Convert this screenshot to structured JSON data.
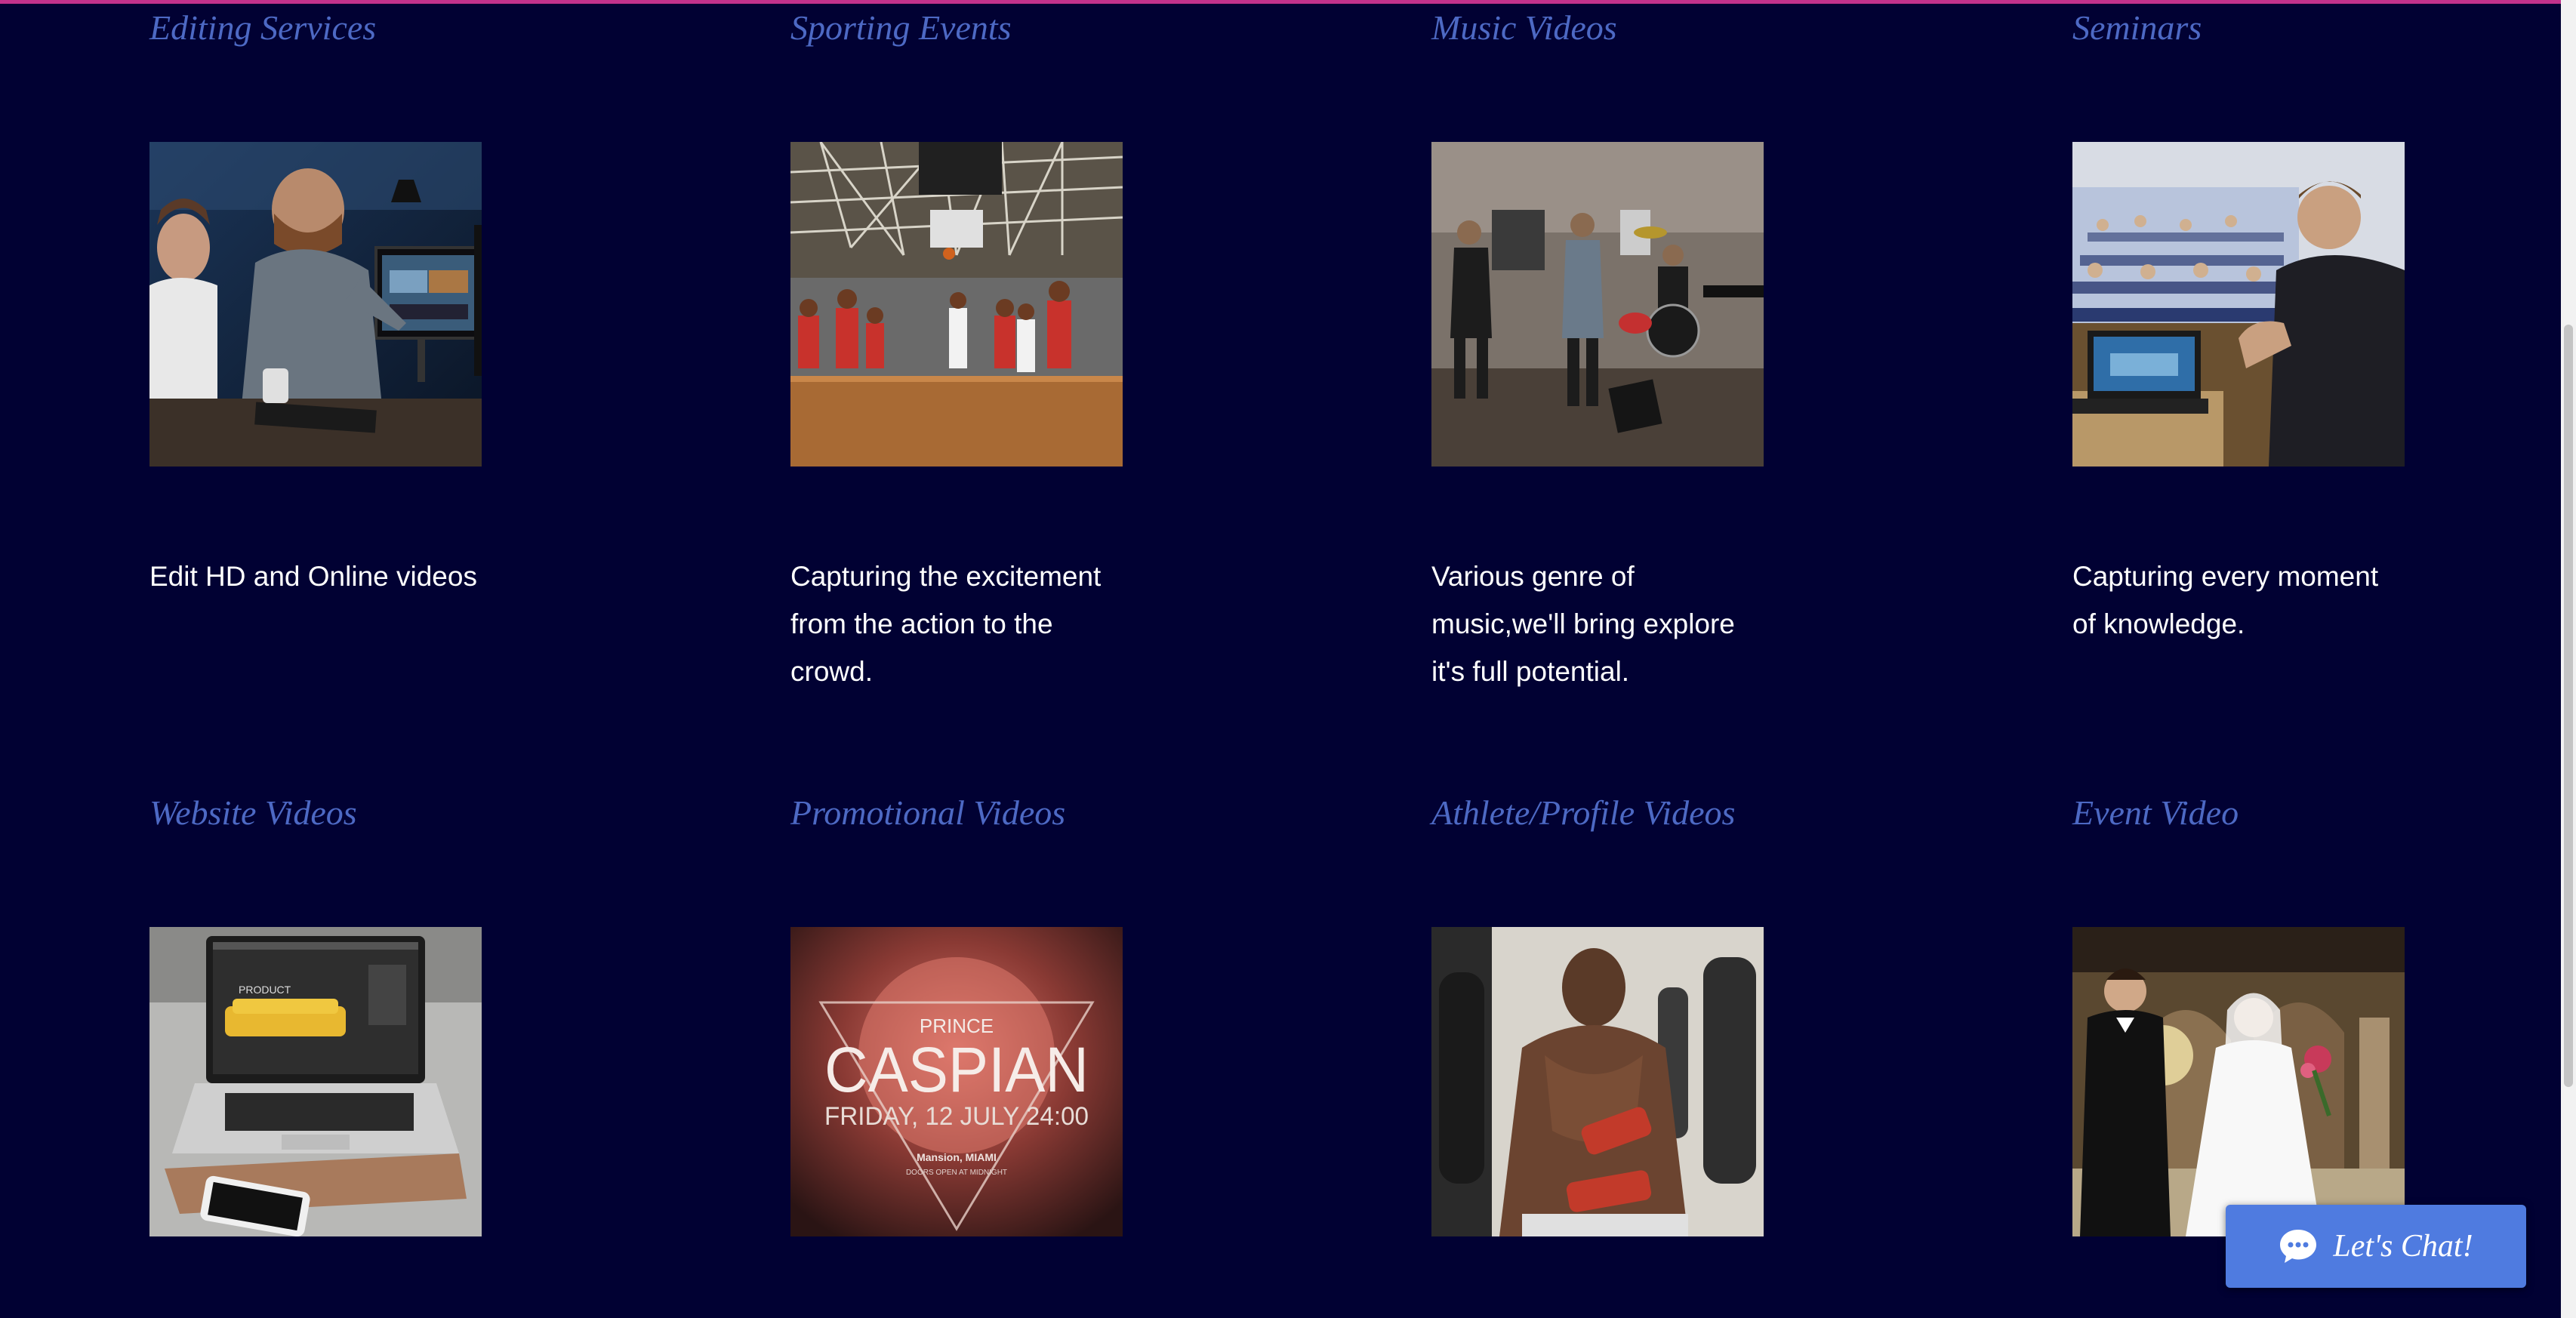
{
  "services": [
    {
      "title": "Editing Services",
      "description": "Edit HD and Online videos",
      "image": "editor-workstation-photo"
    },
    {
      "title": "Sporting Events",
      "description": "Capturing the excitement from the action to the crowd.",
      "image": "basketball-game-photo"
    },
    {
      "title": "Music Videos",
      "description": "Various genre of music,we'll bring explore it's full potential.",
      "image": "band-performance-photo"
    },
    {
      "title": "Seminars",
      "description": "Capturing every moment of knowledge.",
      "image": "seminar-speaker-photo"
    },
    {
      "title": "Website Videos",
      "image": "laptop-website-photo",
      "image_text": "PRODUCT"
    },
    {
      "title": "Promotional Videos",
      "image": "event-poster-photo",
      "poster": {
        "line1": "PRINCE",
        "line2": "CASPIAN",
        "line3": "FRIDAY, 12 JULY 24:00",
        "line4": "Mansion, MIAMI",
        "line5": "DOORS OPEN AT MIDNIGHT"
      }
    },
    {
      "title": "Athlete/Profile Videos",
      "image": "boxer-wrapping-hands-photo"
    },
    {
      "title": "Event Video",
      "image": "wedding-couple-photo"
    }
  ],
  "chat": {
    "label": "Let's Chat!",
    "icon": "chat-bubble-icon"
  },
  "colors": {
    "background": "#010133",
    "title": "#4d69c4",
    "text": "#ffffff",
    "chat": "#4f7be0",
    "topline": "#c2328c"
  }
}
